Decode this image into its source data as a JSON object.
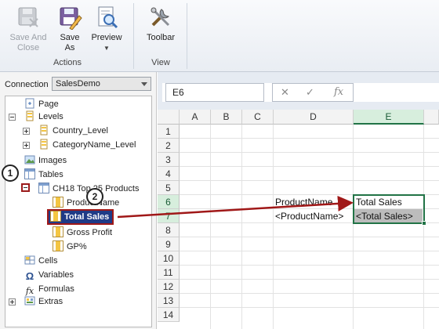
{
  "ribbon": {
    "buttons": [
      {
        "label": "Save And Close",
        "icon": "save-close-icon",
        "enabled": false
      },
      {
        "label": "Save As",
        "icon": "save-as-icon",
        "enabled": true
      },
      {
        "label": "Preview",
        "icon": "preview-icon",
        "enabled": true
      },
      {
        "label": "Toolbar",
        "icon": "toolbar-tools-icon",
        "enabled": true
      }
    ],
    "groups": [
      "Actions",
      "View"
    ]
  },
  "connection": {
    "label": "Connection",
    "value": "SalesDemo"
  },
  "tree": {
    "page": "Page",
    "levels": "Levels",
    "country_level": "Country_Level",
    "categoryname_level": "CategoryName_Level",
    "images": "Images",
    "tables": "Tables",
    "table_name": "CH18 Top 25 Products",
    "product_name": "ProductName",
    "total_sales": "Total Sales",
    "gross_profit": "Gross Profit",
    "gp_percent": "GP%",
    "cells": "Cells",
    "variables": "Variables",
    "formulas": "Formulas",
    "extras": "Extras"
  },
  "callouts": [
    "1",
    "2"
  ],
  "formula_bar": {
    "name_box": "E6",
    "cancel": "✕",
    "enter": "✓",
    "fx": "fx"
  },
  "sheet": {
    "columns": [
      "A",
      "B",
      "C",
      "D",
      "E"
    ],
    "rows": [
      "1",
      "2",
      "3",
      "4",
      "5",
      "6",
      "7",
      "8",
      "9",
      "10",
      "11",
      "12",
      "13",
      "14"
    ],
    "active_column": "E",
    "active_rows": [
      "6",
      "7"
    ],
    "d6": "ProductName",
    "d7": "<ProductName>",
    "e6": "Total Sales",
    "e7": "<Total Sales>"
  },
  "colors": {
    "selection": "#217346",
    "highlight": "#1f3b87",
    "annotation": "#a01818"
  }
}
